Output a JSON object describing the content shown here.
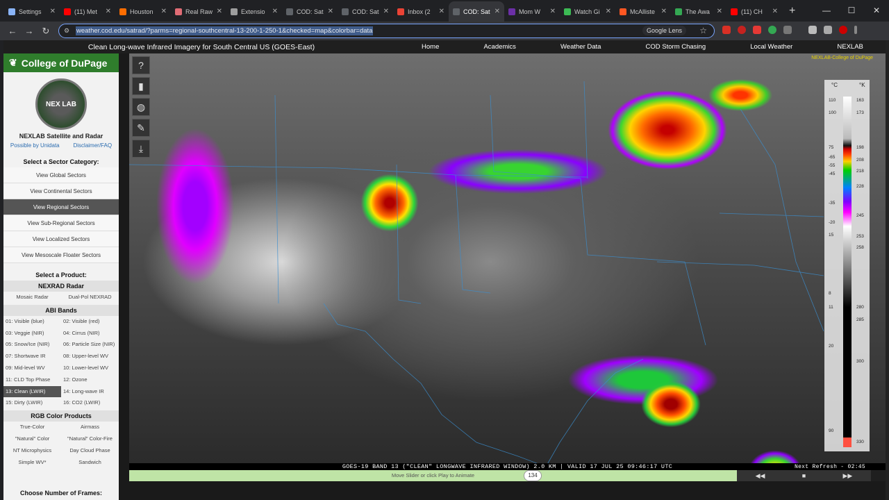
{
  "browser": {
    "tabs": [
      {
        "label": "Settings",
        "color": "#8ab4f8",
        "active": false
      },
      {
        "label": "(11) Met",
        "color": "#ff0000",
        "active": false
      },
      {
        "label": "Houston",
        "color": "#ff6d00",
        "active": false
      },
      {
        "label": "Real Raw",
        "color": "#e06c75",
        "active": false
      },
      {
        "label": "Extensio",
        "color": "#9e9e9e",
        "active": false
      },
      {
        "label": "COD: Sat",
        "color": "#5f6368",
        "active": false
      },
      {
        "label": "COD: Sat",
        "color": "#5f6368",
        "active": false
      },
      {
        "label": "Inbox (2",
        "color": "#ea4335",
        "active": false
      },
      {
        "label": "COD: Sat",
        "color": "#5f6368",
        "active": true
      },
      {
        "label": "Mom W",
        "color": "#6b2fa6",
        "active": false
      },
      {
        "label": "Watch Gi",
        "color": "#3cba54",
        "active": false
      },
      {
        "label": "McAlliste",
        "color": "#ff5722",
        "active": false
      },
      {
        "label": "The Awa",
        "color": "#34a853",
        "active": false
      },
      {
        "label": "(11) CH",
        "color": "#ff0000",
        "active": false
      }
    ],
    "new_tab": "+",
    "url": "weather.cod.edu/satrad/?parms=regional-southcentral-13-200-1-250-1&checked=map&colorbar=data",
    "lens": "Google Lens",
    "window_controls": [
      "—",
      "☐",
      "✕"
    ]
  },
  "page": {
    "title": "Clean Long-wave Infrared Imagery for South Central US (GOES-East)",
    "menu": [
      "Home",
      "Academics",
      "Weather Data",
      "COD Storm Chasing",
      "Local Weather",
      "NEXLAB"
    ]
  },
  "sidebar": {
    "logo": "College of DuPage",
    "seal_text": "NEX  LAB",
    "heading": "NEXLAB Satellite and Radar",
    "links": [
      "Possible by Unidata",
      "Disclaimer/FAQ"
    ],
    "sector_title": "Select a Sector Category:",
    "sectors": [
      {
        "label": "View Global Sectors",
        "selected": false
      },
      {
        "label": "View Continental Sectors",
        "selected": false
      },
      {
        "label": "View Regional Sectors",
        "selected": true
      },
      {
        "label": "View Sub-Regional Sectors",
        "selected": false
      },
      {
        "label": "View Localized Sectors",
        "selected": false
      },
      {
        "label": "View Mesoscale Floater Sectors",
        "selected": false
      }
    ],
    "product_title": "Select a Product:",
    "nexrad_title": "NEXRAD Radar",
    "nexrad": [
      "Mosaic Radar",
      "Dual-Pol NEXRAD"
    ],
    "abi_title": "ABI Bands",
    "abi": [
      {
        "label": "01: Visible (blue)",
        "selected": false
      },
      {
        "label": "02: Visible (red)",
        "selected": false
      },
      {
        "label": "03: Veggie (NIR)",
        "selected": false
      },
      {
        "label": "04: Cirrus (NIR)",
        "selected": false
      },
      {
        "label": "05: Snow/Ice (NIR)",
        "selected": false
      },
      {
        "label": "06: Particle Size (NIR)",
        "selected": false
      },
      {
        "label": "07: Shortwave IR",
        "selected": false
      },
      {
        "label": "08: Upper-level WV",
        "selected": false
      },
      {
        "label": "09: Mid-level WV",
        "selected": false
      },
      {
        "label": "10: Lower-level WV",
        "selected": false
      },
      {
        "label": "11: CLD Top Phase",
        "selected": false
      },
      {
        "label": "12: Ozone",
        "selected": false
      },
      {
        "label": "13: Clean (LWIR)",
        "selected": true
      },
      {
        "label": "14: Long-wave IR",
        "selected": false
      },
      {
        "label": "15: Dirty (LWIR)",
        "selected": false
      },
      {
        "label": "16: CO2 (LWIR)",
        "selected": false
      }
    ],
    "rgb_title": "RGB Color Products",
    "rgb": [
      "True-Color",
      "Airmass",
      "\"Natural\" Color",
      "\"Natural\" Color-Fire",
      "NT Microphysics",
      "Day Cloud Phase",
      "Simple WV*",
      "Sandwich"
    ],
    "frames_title": "Choose Number of Frames:"
  },
  "map": {
    "tools": [
      "?",
      "▮",
      "◍",
      "✎",
      "⤓"
    ],
    "tool_names": [
      "help-icon",
      "flashlight-icon",
      "globe-icon",
      "draw-icon",
      "download-icon"
    ],
    "credit": "NEXLAB-College of DuPage",
    "colorbar": {
      "unit_c": "°C",
      "unit_k": "°K",
      "c_ticks": [
        "110",
        "100",
        "75",
        "-65",
        "-55",
        "-45",
        "-35",
        "-20",
        "15",
        "8",
        "11",
        "20",
        "90"
      ],
      "k_ticks": [
        "163",
        "173",
        "198",
        "208",
        "218",
        "228",
        "245",
        "253",
        "258",
        "280",
        "285",
        "300",
        "330"
      ]
    },
    "caption": "GOES-19 BAND 13 (\"CLEAN\" LONGWAVE INFRARED WINDOW) 2.0 KM | VALID 17 JUL 25 09:46:17 UTC",
    "refresh": "Next Refresh - 02:45"
  },
  "animation": {
    "hint": "Move Slider or click Play to Animate",
    "frame": "134",
    "buttons": [
      "◀◀",
      "■",
      "▶▶"
    ]
  }
}
